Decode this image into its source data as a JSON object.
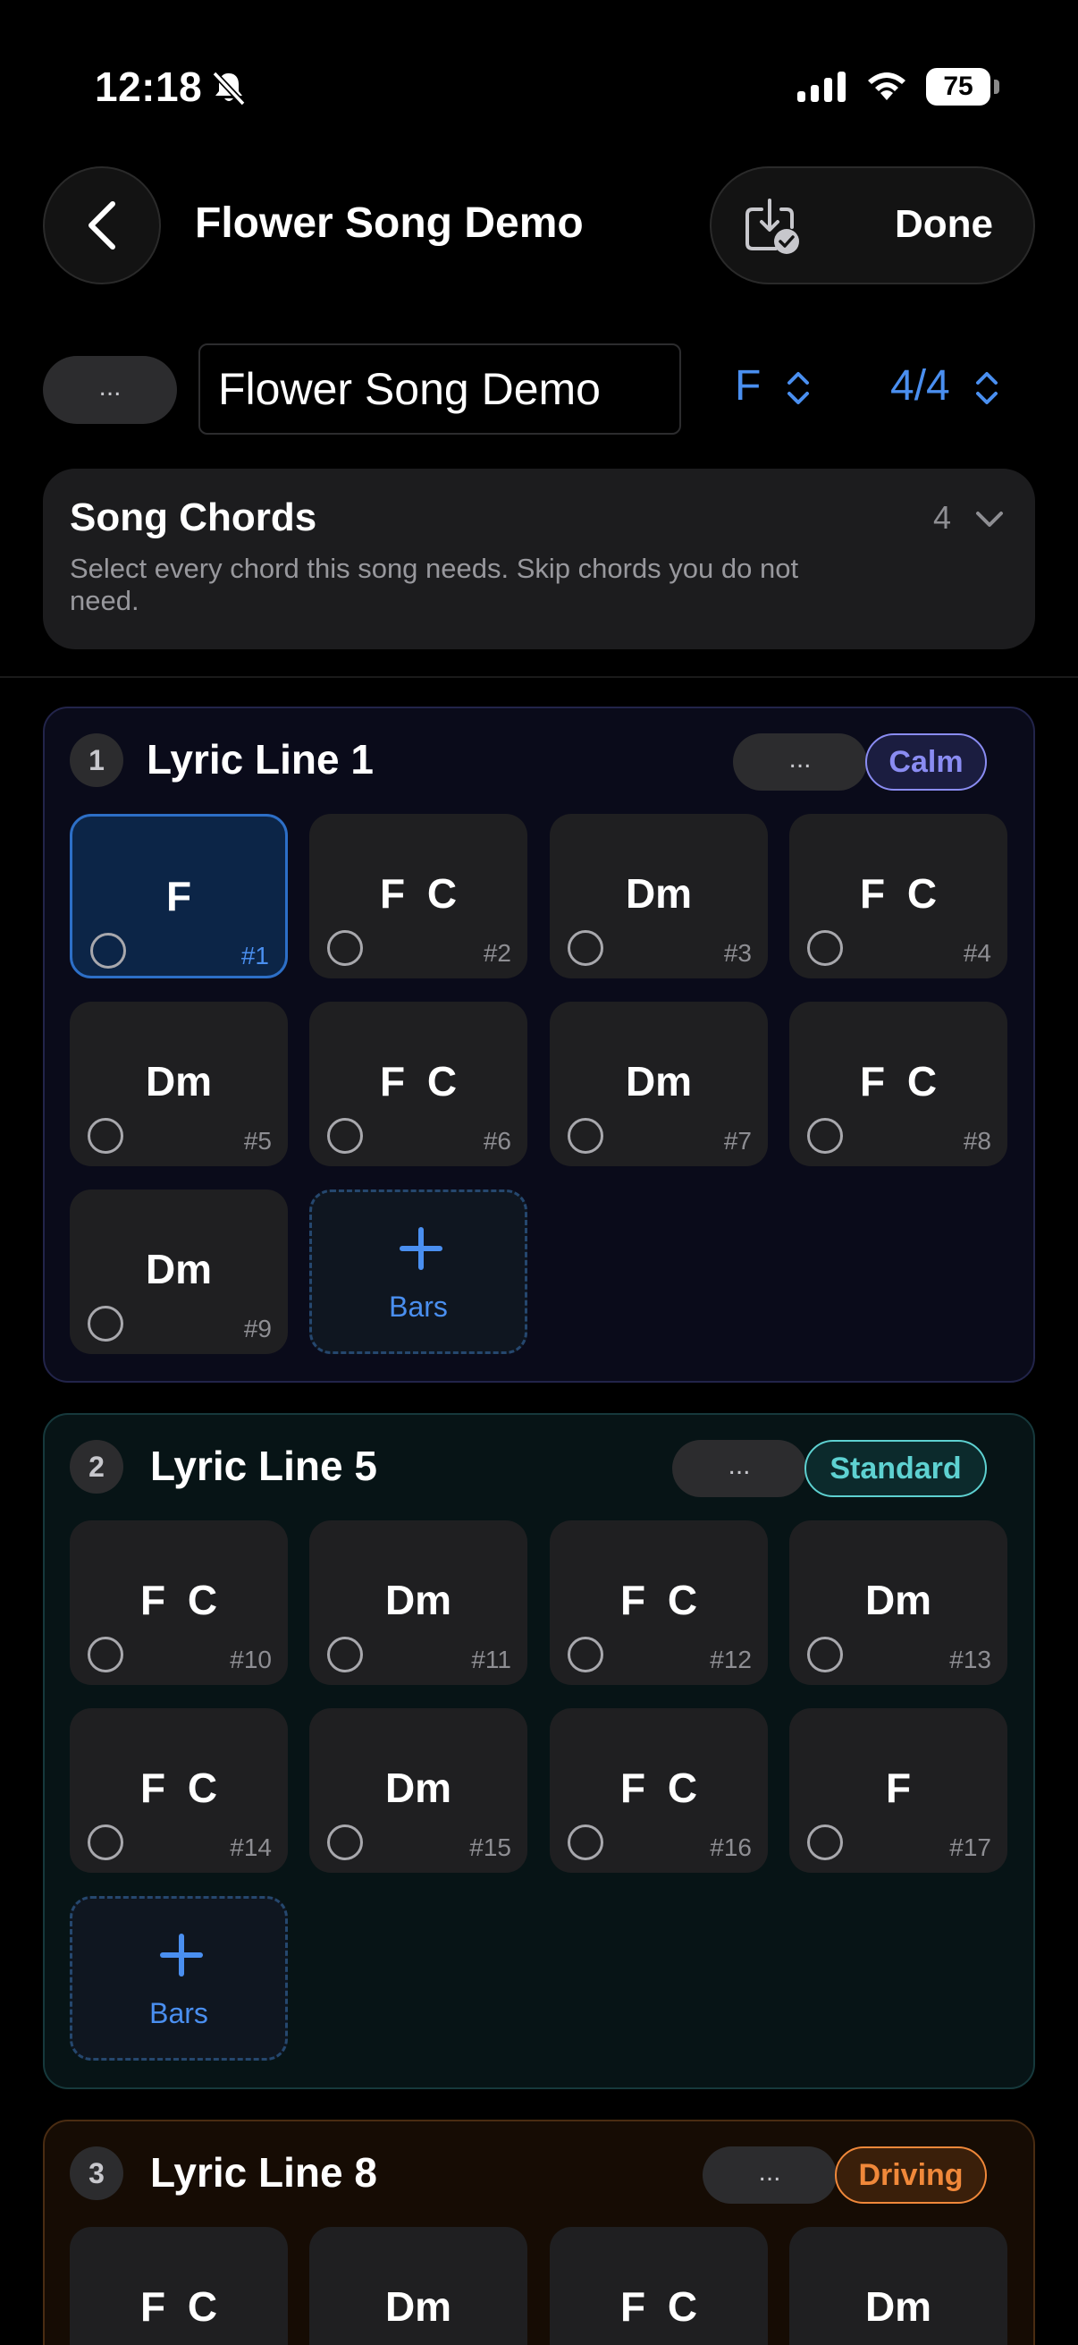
{
  "status": {
    "time": "12:18",
    "battery": "75"
  },
  "header": {
    "title": "Flower Song Demo",
    "done_label": "Done"
  },
  "toolbar": {
    "more_label": "...",
    "song_name": "Flower Song Demo",
    "key": "F",
    "time_signature": "4/4"
  },
  "song_chords": {
    "title": "Song Chords",
    "description": "Select every chord this song needs. Skip chords you do not need.",
    "count": "4"
  },
  "colors": {
    "accent": "#4a8ff0",
    "calm": "#8a8cf2",
    "standard": "#5ed1d1",
    "driving": "#f0883a"
  },
  "sections": [
    {
      "number": "1",
      "title": "Lyric Line 1",
      "more_label": "...",
      "tag": "Calm",
      "add_label": "Bars",
      "bars": [
        {
          "chord": "F",
          "num": "#1",
          "active": true
        },
        {
          "chord": "F C",
          "num": "#2"
        },
        {
          "chord": "Dm",
          "num": "#3"
        },
        {
          "chord": "F C",
          "num": "#4"
        },
        {
          "chord": "Dm",
          "num": "#5"
        },
        {
          "chord": "F C",
          "num": "#6"
        },
        {
          "chord": "Dm",
          "num": "#7"
        },
        {
          "chord": "F C",
          "num": "#8"
        },
        {
          "chord": "Dm",
          "num": "#9"
        }
      ]
    },
    {
      "number": "2",
      "title": "Lyric Line 5",
      "more_label": "...",
      "tag": "Standard",
      "add_label": "Bars",
      "bars": [
        {
          "chord": "F C",
          "num": "#10"
        },
        {
          "chord": "Dm",
          "num": "#11"
        },
        {
          "chord": "F C",
          "num": "#12"
        },
        {
          "chord": "Dm",
          "num": "#13"
        },
        {
          "chord": "F C",
          "num": "#14"
        },
        {
          "chord": "Dm",
          "num": "#15"
        },
        {
          "chord": "F C",
          "num": "#16"
        },
        {
          "chord": "F",
          "num": "#17"
        }
      ]
    },
    {
      "number": "3",
      "title": "Lyric Line 8",
      "more_label": "...",
      "tag": "Driving",
      "bars": [
        {
          "chord": "F C"
        },
        {
          "chord": "Dm"
        },
        {
          "chord": "F C"
        },
        {
          "chord": "Dm"
        }
      ]
    }
  ]
}
